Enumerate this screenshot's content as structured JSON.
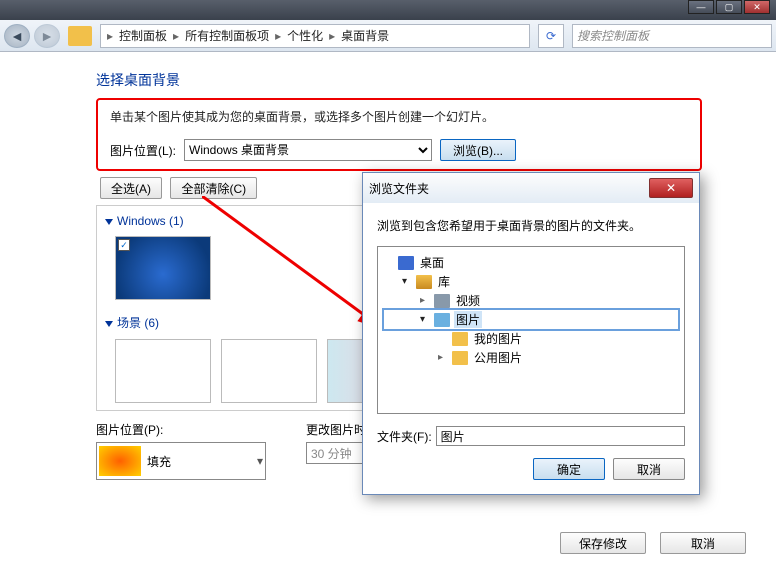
{
  "titlebar": {
    "min": "—",
    "max": "▢",
    "close": "✕"
  },
  "nav": {
    "crumbs": [
      "控制面板",
      "所有控制面板项",
      "个性化",
      "桌面背景"
    ],
    "search_placeholder": "搜索控制面板",
    "refresh_icon": "⟳"
  },
  "main": {
    "heading": "选择桌面背景",
    "desc": "单击某个图片使其成为您的桌面背景，或选择多个图片创建一个幻灯片。",
    "location_label": "图片位置(L):",
    "location_value": "Windows 桌面背景",
    "browse_btn": "浏览(B)...",
    "select_all": "全选(A)",
    "clear_all": "全部清除(C)",
    "sections": [
      {
        "title": "Windows (1)"
      },
      {
        "title": "场景 (6)"
      }
    ],
    "pos_label": "图片位置(P):",
    "fit_value": "填充",
    "interval_label": "更改图片时间间",
    "interval_value": "30 分钟",
    "save": "保存修改",
    "cancel": "取消"
  },
  "dialog": {
    "title": "浏览文件夹",
    "msg": "浏览到包含您希望用于桌面背景的图片的文件夹。",
    "tree": {
      "desktop": "桌面",
      "lib": "库",
      "video": "视频",
      "pictures": "图片",
      "mypics": "我的图片",
      "publicpics": "公用图片"
    },
    "folder_label": "文件夹(F):",
    "folder_value": "图片",
    "ok": "确定",
    "cancel": "取消",
    "close": "✕"
  }
}
